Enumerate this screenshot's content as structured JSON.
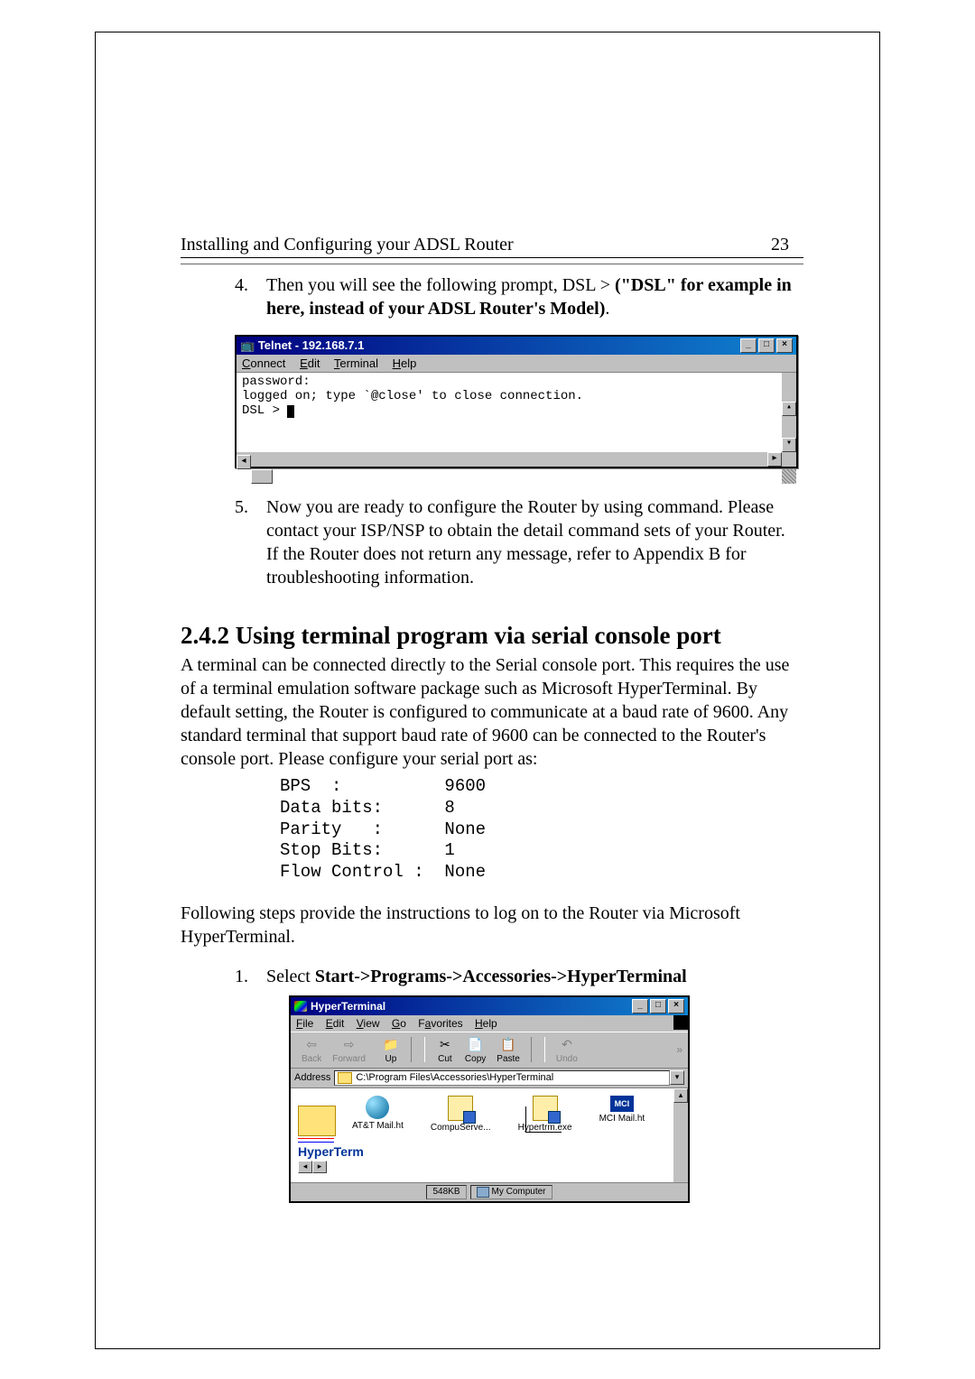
{
  "header": {
    "title": "Installing and Configuring your ADSL Router",
    "page_number": "23"
  },
  "step4": {
    "num": "4.",
    "text_a": "Then you will see the following prompt, DSL > ",
    "text_b": "(\"DSL\" for example in here, instead of your ADSL Router's Model)",
    "text_c": "."
  },
  "telnet": {
    "title": "Telnet - 192.168.7.1",
    "menu": {
      "connect": "Connect",
      "edit": "Edit",
      "terminal": "Terminal",
      "help": "Help"
    },
    "line1": "password:",
    "line2": "logged on; type `@close' to close connection.",
    "line3": "DSL > "
  },
  "step5": {
    "num": "5.",
    "text": "Now you are ready to configure the Router by using command. Please contact your ISP/NSP to obtain the detail command sets of your Router. If the Router does not return any message, refer to Appendix B for troubleshooting information."
  },
  "section": {
    "heading": "2.4.2 Using terminal program via serial console port",
    "para1": "A terminal can be connected directly to the Serial console port. This requires the use of a terminal emulation software package such as Microsoft HyperTerminal. By default setting, the Router is configured to communicate at a baud rate of 9600. Any standard terminal that support baud rate of 9600 can be connected to the Router's console port. Please configure your serial port as:",
    "settings": "BPS  :          9600\nData bits:      8\nParity   :      None\nStop Bits:      1\nFlow Control :  None",
    "para2": "Following steps provide the instructions to log on to the Router via Microsoft HyperTerminal."
  },
  "step1": {
    "num": "1.",
    "text_a": "Select ",
    "text_b": "Start->Programs->Accessories->HyperTerminal"
  },
  "ht": {
    "title": "HyperTerminal",
    "menu": {
      "file": "File",
      "edit": "Edit",
      "view": "View",
      "go": "Go",
      "favorites": "Favorites",
      "help": "Help"
    },
    "toolbar": {
      "back": "Back",
      "forward": "Forward",
      "up": "Up",
      "cut": "Cut",
      "copy": "Copy",
      "paste": "Paste",
      "undo": "Undo"
    },
    "address_label": "Address",
    "address_path": "C:\\Program Files\\Accessories\\HyperTerminal",
    "files": {
      "att": "AT&T Mail.ht",
      "compu": "CompuServe...",
      "hyper": "Hypertrm.exe",
      "mci": "MCI Mail.ht"
    },
    "folder_label": "HyperTerm",
    "status_size": "548KB",
    "status_loc": "My Computer"
  }
}
